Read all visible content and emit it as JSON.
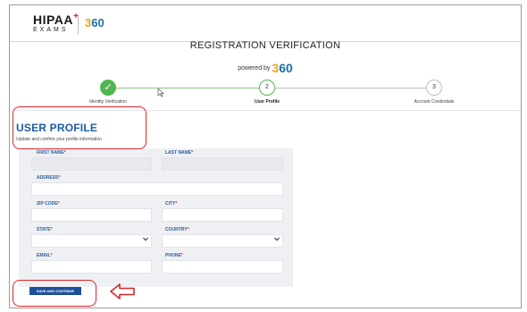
{
  "logo": {
    "hipaa": "HIPAA",
    "exams": "EXAMS",
    "badge_360_a": "3",
    "badge_360_b": "60"
  },
  "header": {
    "title": "REGISTRATION VERIFICATION",
    "powered_by": "powered by",
    "powered_logo_a": "3",
    "powered_logo_b": "60"
  },
  "steps": [
    {
      "num": "✓",
      "label": "Identity Verification",
      "state": "done"
    },
    {
      "num": "2",
      "label": "User Profile",
      "state": "active"
    },
    {
      "num": "3",
      "label": "Account Credentials",
      "state": "pending"
    }
  ],
  "profile": {
    "title": "USER PROFILE",
    "subtitle": "Update and confirm your profile information"
  },
  "fields": {
    "first_name": {
      "label": "FIRST NAME",
      "required": "*",
      "value": ""
    },
    "last_name": {
      "label": "LAST NAME",
      "required": "*",
      "value": ""
    },
    "address": {
      "label": "ADDRESS",
      "required": "*",
      "value": ""
    },
    "zip_code": {
      "label": "ZIP CODE",
      "required": "*",
      "value": ""
    },
    "city": {
      "label": "CITY",
      "required": "*",
      "value": ""
    },
    "state": {
      "label": "STATE",
      "required": "*",
      "value": ""
    },
    "country": {
      "label": "COUNTRY",
      "required": "*",
      "value": ""
    },
    "email": {
      "label": "EMAIL",
      "required": "*",
      "value": ""
    },
    "phone": {
      "label": "PHONE",
      "required": "*",
      "value": ""
    }
  },
  "buttons": {
    "save_continue": "SAVE AND CONTINUE"
  },
  "colors": {
    "accent": "#1e5ba8",
    "success": "#52b551",
    "highlight": "#d9262c",
    "button": "#1f4f9a"
  },
  "icons": {
    "step_done": "checkmark-icon",
    "select_chevron": "chevron-down-icon",
    "annotation_arrow": "left-arrow-icon",
    "cursor": "mouse-pointer-icon"
  }
}
